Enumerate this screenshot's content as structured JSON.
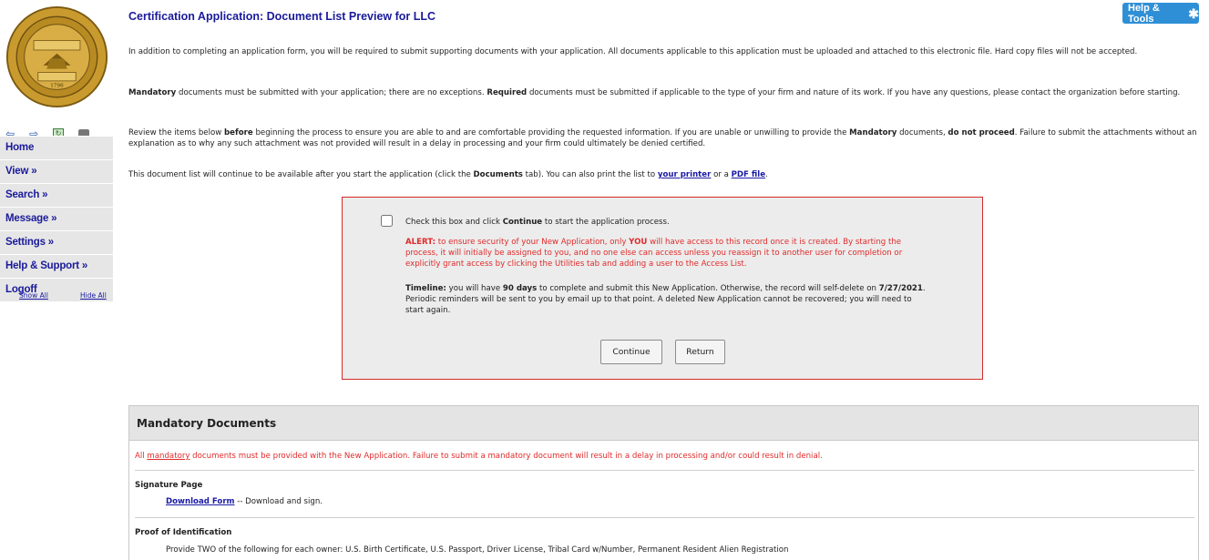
{
  "header": {
    "title": "Certification Application: Document List Preview for LLC",
    "help_tools_label": "Help & Tools"
  },
  "seal": {
    "ring_text": "THE GREAT SEAL OF THE STATE OF TENNESSEE",
    "top_word": "AGRICULTURE",
    "bottom_word": "COMMERCE",
    "year": "1796"
  },
  "nav_icons": [
    "back-arrow-icon",
    "forward-arrow-icon",
    "refresh-icon",
    "print-icon"
  ],
  "sidebar": {
    "items": [
      {
        "label": "Home"
      },
      {
        "label": "View »"
      },
      {
        "label": "Search »"
      },
      {
        "label": "Message »"
      },
      {
        "label": "Settings »"
      },
      {
        "label": "Help & Support »"
      },
      {
        "label": "Logoff"
      }
    ],
    "show_all": "Show All",
    "hide_all": "Hide All"
  },
  "intro": {
    "p1": "In addition to completing an application form, you will be required to submit supporting documents with your application. All documents applicable to this application must be uploaded and attached to this electronic file. Hard copy files will not be accepted.",
    "p2_b1": "Mandatory",
    "p2_t1": " documents must be submitted with your application; there are no exceptions. ",
    "p2_b2": "Required",
    "p2_t2": " documents must be submitted if applicable to the type of your firm and nature of its work. If you have any questions, please contact the organization before starting.",
    "p3_t1": "Review the items below ",
    "p3_b1": "before",
    "p3_t2": " beginning the process to ensure you are able to and are comfortable providing the requested information. If you are unable or unwilling to provide the ",
    "p3_b2": "Mandatory",
    "p3_t3": " documents, ",
    "p3_b3": "do not proceed",
    "p3_t4": ". Failure to submit the attachments without an explanation as to why any such attachment was not provided will result in a delay in processing and your firm could ultimately be denied certified.",
    "p4_t1": "This document list will continue to be available after you start the application (click the ",
    "p4_b1": "Documents",
    "p4_t2": " tab). You can also print the list to ",
    "p4_link1": "your printer",
    "p4_t3": " or a ",
    "p4_link2": "PDF file",
    "p4_t4": "."
  },
  "start_box": {
    "instr_t1": "Check this box and click ",
    "instr_b1": "Continue",
    "instr_t2": " to start the application process.",
    "alert_b1": "ALERT:",
    "alert_t1": " to ensure security of your New Application, only ",
    "alert_b2": "YOU",
    "alert_t2": " will have access to this record once it is created. By starting the process, it will initially be assigned to you, and no one else can access unless you reassign it to another user for completion or explicitly grant access by clicking the Utilities tab and adding a user to the Access List.",
    "tl_b1": "Timeline:",
    "tl_t1": " you will have ",
    "tl_b2": "90 days",
    "tl_t2": " to complete and submit this New Application. Otherwise, the record will self-delete on ",
    "tl_b3": "7/27/2021",
    "tl_t3": ". Periodic reminders will be sent to you by email up to that point. A deleted New Application cannot be recovered; you will need to start again.",
    "continue_label": "Continue",
    "return_label": "Return"
  },
  "mandatory": {
    "heading": "Mandatory Documents",
    "note_t1": "All ",
    "note_link": "mandatory",
    "note_t2": " documents must be provided with the New Application. Failure to submit a mandatory document will result in a delay in processing and/or could result in denial.",
    "signature_title": "Signature Page",
    "download_link": "Download Form",
    "download_text": " -- Download and sign.",
    "id_title": "Proof of Identification",
    "id_text": "Provide TWO of the following for each owner: U.S. Birth Certificate, U.S. Passport, Driver License, Tribal Card w/Number, Permanent Resident Alien Registration"
  },
  "colors": {
    "nav_text": "#1a1a9a",
    "alert_red": "#e02a2a",
    "box_border": "#d42a2a",
    "help_button": "#2f8fd6",
    "seal_gold": "#c99a2e"
  }
}
